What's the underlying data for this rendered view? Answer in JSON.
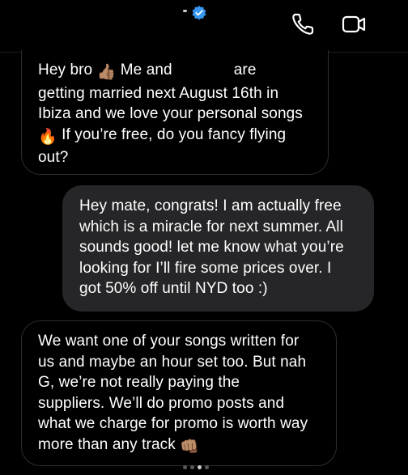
{
  "header": {
    "verified_icon": "verified-badge-icon",
    "call_icon": "phone-icon",
    "video_icon": "video-camera-icon",
    "accent": "#3797f0"
  },
  "messages": [
    {
      "direction": "incoming",
      "lines": [
        {
          "a": "Hey bro ",
          "emoji": "👍🏽",
          "b": " Me and",
          "c": "are"
        },
        {
          "text": "getting married next August 16th in"
        },
        {
          "text": "Ibiza and we love your personal songs"
        },
        {
          "emoji": "🔥",
          "text": " If you’re free, do you fancy flying"
        },
        {
          "text": "out?"
        }
      ]
    },
    {
      "direction": "outgoing",
      "lines": [
        {
          "text": "Hey mate, congrats! I am actually free"
        },
        {
          "text": "which is a miracle for next summer. All"
        },
        {
          "text": "sounds good! let me know what you’re"
        },
        {
          "text": "looking for I’ll fire some prices over. I"
        },
        {
          "text": "got 50% off until NYD too :)"
        }
      ]
    },
    {
      "direction": "incoming",
      "lines": [
        {
          "text": "We want one of your songs written for"
        },
        {
          "text": "us and maybe an hour set too. But nah"
        },
        {
          "text": "G, we’re not really paying the"
        },
        {
          "text": "suppliers. We’ll do promo posts and"
        },
        {
          "text": "what we charge for promo is worth way"
        },
        {
          "text": "more than any track",
          "emoji": "👊🏽"
        }
      ]
    }
  ],
  "pager": {
    "count": 4,
    "active_index": 2
  }
}
